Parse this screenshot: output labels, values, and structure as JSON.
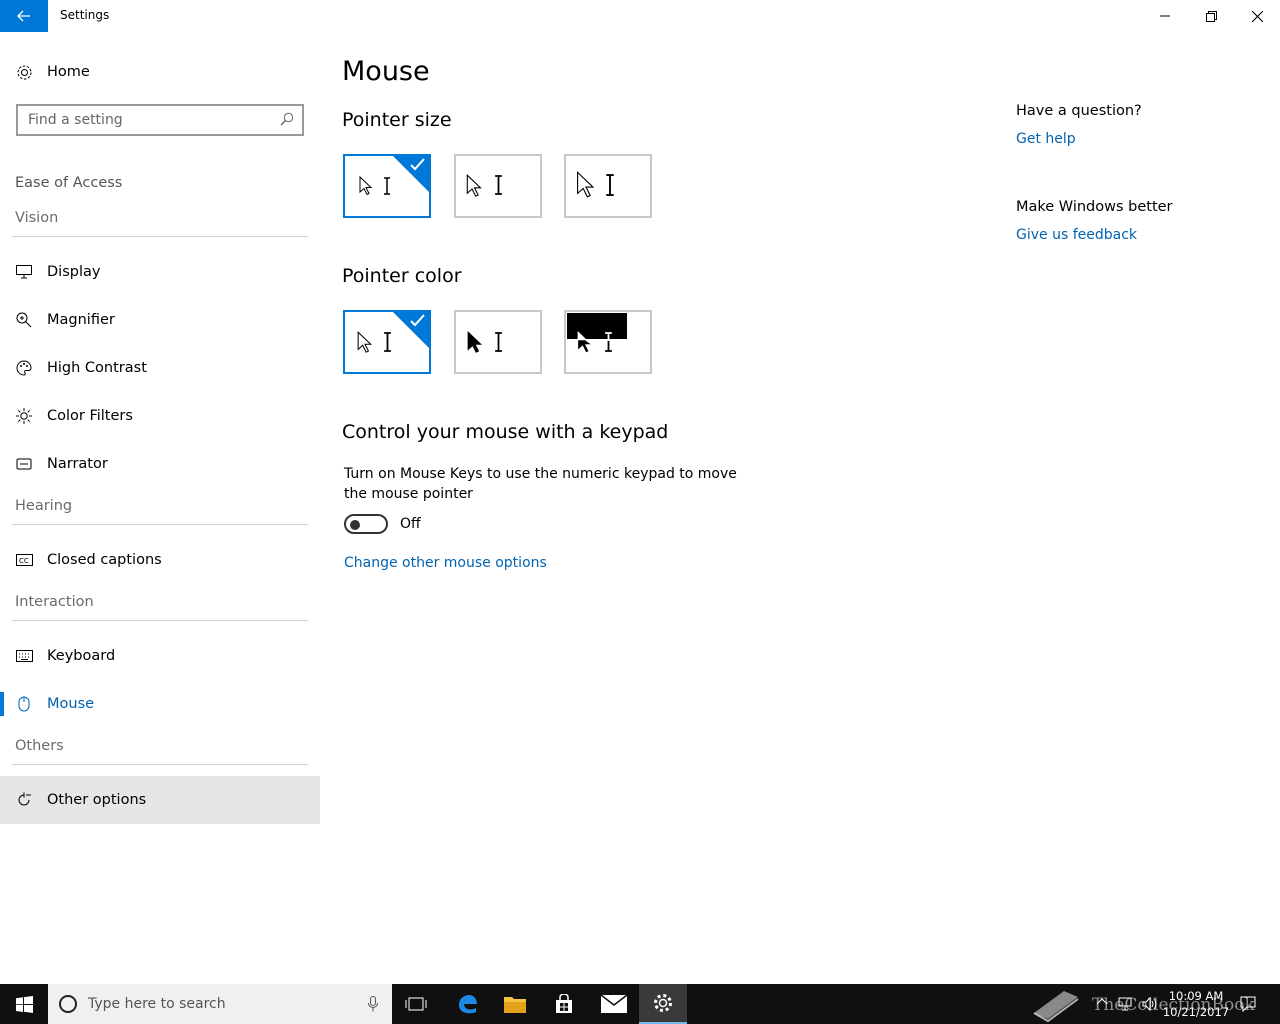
{
  "window": {
    "title": "Settings"
  },
  "sidebar": {
    "home_label": "Home",
    "search_placeholder": "Find a setting",
    "category": "Ease of Access",
    "groups": {
      "vision": "Vision",
      "hearing": "Hearing",
      "interaction": "Interaction",
      "others": "Others"
    },
    "items": {
      "display": "Display",
      "magnifier": "Magnifier",
      "high_contrast": "High Contrast",
      "color_filters": "Color Filters",
      "narrator": "Narrator",
      "closed_captions": "Closed captions",
      "keyboard": "Keyboard",
      "mouse": "Mouse",
      "other_options": "Other options"
    },
    "active_item": "Mouse"
  },
  "main": {
    "title": "Mouse",
    "pointer_size": {
      "heading": "Pointer size",
      "selected_index": 0,
      "option_count": 3
    },
    "pointer_color": {
      "heading": "Pointer color",
      "selected_index": 0,
      "option_count": 3
    },
    "keypad": {
      "heading": "Control your mouse with a keypad",
      "description": "Turn on Mouse Keys to use the numeric keypad to move the mouse pointer",
      "toggle_state": "Off",
      "link": "Change other mouse options"
    }
  },
  "help": {
    "question_heading": "Have a question?",
    "get_help": "Get help",
    "feedback_heading": "Make Windows better",
    "give_feedback": "Give us feedback"
  },
  "taskbar": {
    "search_placeholder": "Type here to search",
    "time": "10:09 AM",
    "date": "10/21/2017",
    "watermark": "TheCollectionBook"
  },
  "colors": {
    "accent": "#0078d7",
    "link": "#0063b1",
    "taskbar": "#101010"
  }
}
